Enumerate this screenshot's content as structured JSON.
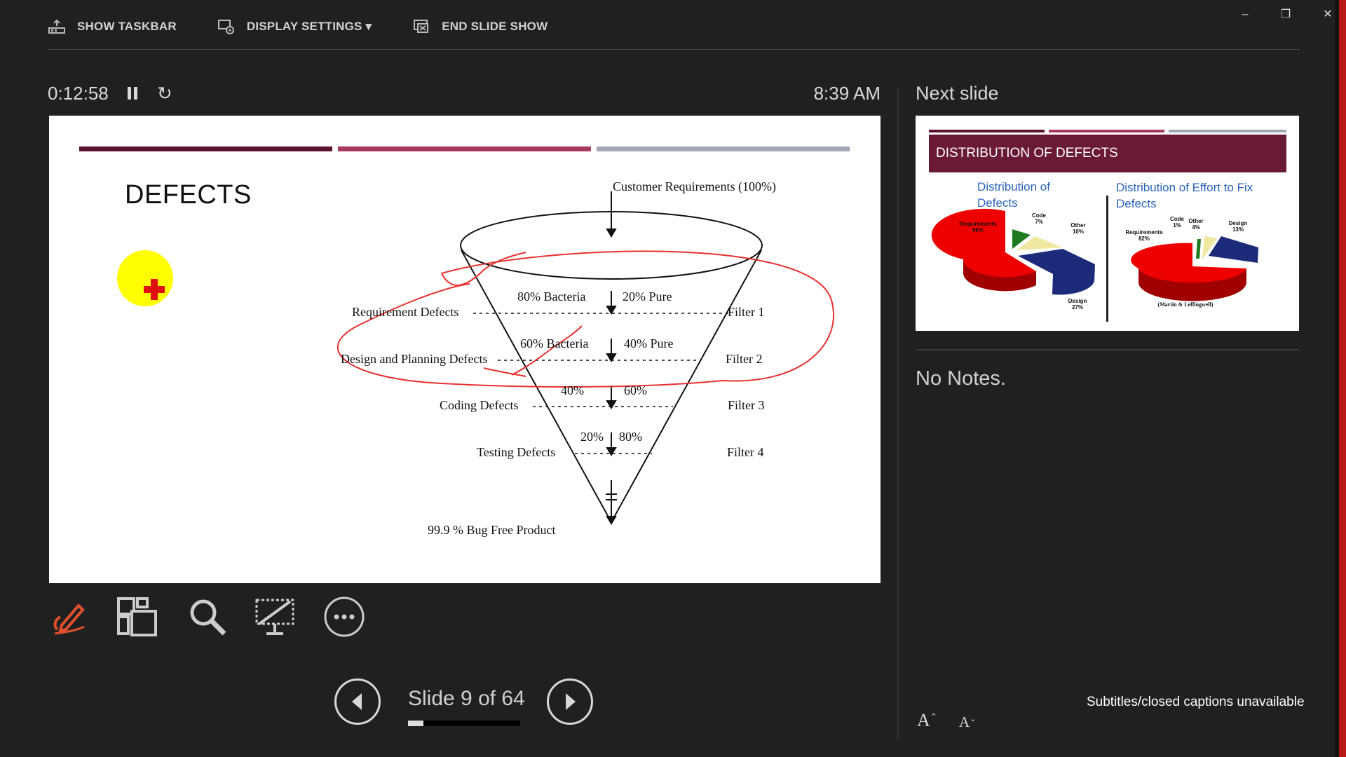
{
  "toolbar": {
    "show_taskbar": "SHOW TASKBAR",
    "display_settings": "DISPLAY SETTINGS ▾",
    "end_slide_show": "END SLIDE SHOW"
  },
  "window": {
    "minimize": "–",
    "restore": "❐",
    "close": "✕"
  },
  "presenter": {
    "timer": "0:12:58",
    "clock": "8:39 AM",
    "reset_icon": "↻"
  },
  "slide": {
    "title": "DEFECTS",
    "bar_colors": [
      "#5a1430",
      "#a8385e",
      "#a2a8b2"
    ],
    "funnel": {
      "top_label": "Customer Requirements (100%)",
      "stages": [
        {
          "name": "Requirement Defects",
          "left": "80% Bacteria",
          "right": "20% Pure",
          "filter": "Filter 1"
        },
        {
          "name": "Design and Planning Defects",
          "left": "60% Bacteria",
          "right": "40% Pure",
          "filter": "Filter 2"
        },
        {
          "name": "Coding Defects",
          "left": "40%",
          "right": "60%",
          "filter": "Filter 3"
        },
        {
          "name": "Testing Defects",
          "left": "20%",
          "right": "80%",
          "filter": "Filter 4"
        }
      ],
      "bottom_label": "99.9 % Bug Free Product"
    },
    "annotation_color": "#e83030",
    "pointer_color": "#ffff00"
  },
  "next": {
    "label": "Next slide",
    "title": "DISTRIBUTION OF DEFECTS",
    "left_chart_title": "Distribution of Defects",
    "right_chart_title": "Distribution of Effort to Fix Defects",
    "left_labels": {
      "requirements": "Requirements 56%",
      "code": "Code 7%",
      "other": "Other 10%",
      "design": "Design 27%"
    },
    "right_labels": {
      "requirements": "Requirements 82%",
      "code": "Code 1%",
      "other": "Other 4%",
      "design": "Design 13%"
    },
    "citation": "(Martin & Leffingwell)",
    "header_color": "#6a1a36"
  },
  "notes": {
    "text": "No Notes."
  },
  "navigation": {
    "counter": "Slide 9 of 64",
    "progress_fraction": 0.14
  },
  "font_controls": {
    "increase": "A",
    "decrease": "A"
  },
  "captions": "Subtitles/closed captions unavailable"
}
